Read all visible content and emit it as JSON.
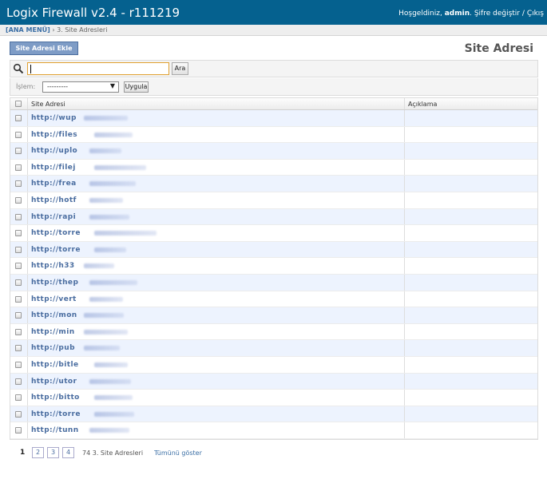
{
  "header": {
    "title": "Logix Firewall v2.4 - r111219",
    "welcome": "Hoşgeldiniz,",
    "username": "admin",
    "change_password": "Şifre değiştir",
    "separator": "/",
    "logout": "Çıkış"
  },
  "breadcrumbs": {
    "home": "[ANA MENÜ]",
    "sep": "›",
    "current": "3. Site Adresleri"
  },
  "add_button": "Site Adresi Ekle",
  "page_heading": "Site Adresi",
  "search": {
    "value": "",
    "button": "Ara"
  },
  "actions": {
    "label": "İşlem:",
    "selected": "---------",
    "apply": "Uygula"
  },
  "table": {
    "columns": [
      "Site Adresi",
      "Açıklama"
    ],
    "rows": [
      "http://wup",
      "http://files",
      "http://uplo",
      "http://filej",
      "http://frea",
      "http://hotf",
      "http://rapi",
      "http://torre",
      "http://torre",
      "http://h33",
      "http://thep",
      "http://vert",
      "http://mon",
      "http://min",
      "http://pub",
      "http://bitle",
      "http://utor",
      "http://bitto",
      "http://torre",
      "http://tunn"
    ]
  },
  "pagination": {
    "current": "1",
    "pages": [
      "2",
      "3",
      "4"
    ],
    "count": "74 3. Site Adresleri",
    "show_all": "Tümünü göster"
  }
}
